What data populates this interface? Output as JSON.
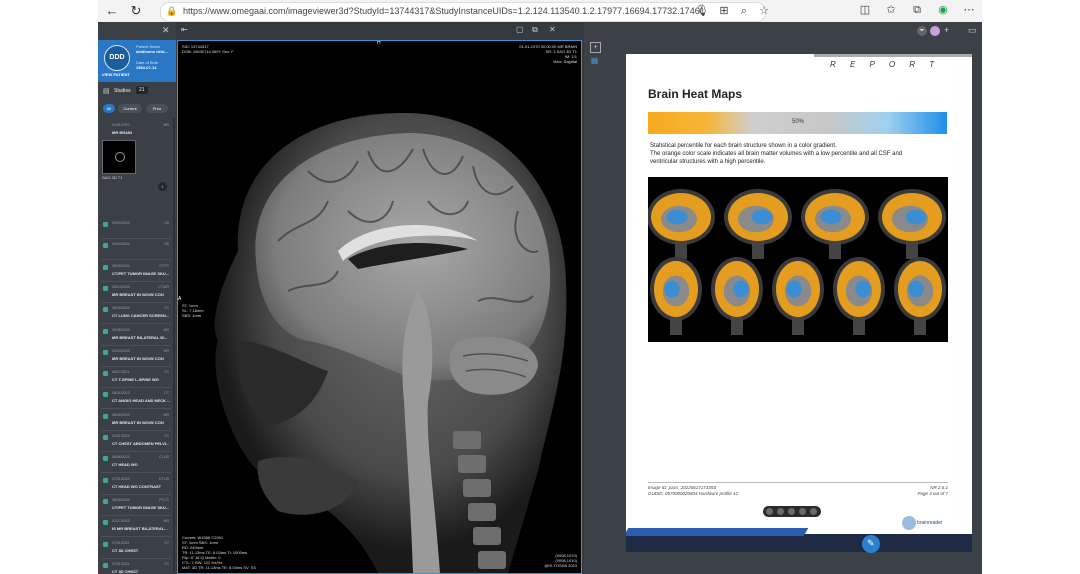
{
  "browser": {
    "url": "https://www.omegaai.com/imageviewer3d?StudyId=13744317&StudyInstanceUIDs=1.2.124.113540.1.2.17977.16694.17732.17460&PatientInfo=12..."
  },
  "sidebar": {
    "patient": {
      "avatar": "DDD",
      "name_label": "Patient Name",
      "name": "deidlonnn deid...",
      "view_label": "VIEW PATIENT",
      "dob_label": "Date of Birth",
      "dob": "1964-07-14"
    },
    "studies_label": "Studies",
    "studies_count": "21",
    "filters": [
      "All",
      "Current",
      "Prior"
    ],
    "current_study": {
      "date": "01/01/1970",
      "mod": "MR",
      "desc": "MR BRAIN",
      "thumb_label": "SAG 3D T1",
      "series_count": "1"
    },
    "studies": [
      {
        "date": "09/09/2024",
        "mod": "US",
        "desc": ""
      },
      {
        "date": "04/29/2024",
        "mod": "US",
        "desc": ""
      },
      {
        "date": "08/08/2024",
        "mod": "CT,PT",
        "desc": "CT/PET TUMOR IMAGE SKU..."
      },
      {
        "date": "08/14/2024",
        "mod": "CT,MR",
        "desc": "MR BREAST BI WO/W CON"
      },
      {
        "date": "06/16/2023",
        "mod": "CT",
        "desc": "CT LUNG CANCER SCREEN..."
      },
      {
        "date": "06/08/2023",
        "mod": "MR",
        "desc": "MR BREAST BILATERAL W..."
      },
      {
        "date": "03/03/2023",
        "mod": "MR",
        "desc": "MR BREAST BI WO/W CON"
      },
      {
        "date": "08/27/2021",
        "mod": "CT",
        "desc": "CT T-SPINE L-SPINE WO"
      },
      {
        "date": "08/31/2023",
        "mod": "CT",
        "desc": "CT ANGIO HEAD AND NECK ..."
      },
      {
        "date": "08/09/2023",
        "mod": "MR",
        "desc": "MR BREAST BI WO/W CON"
      },
      {
        "date": "04/21/2023",
        "mod": "CT",
        "desc": "CT CHEST ABDOMEN PELVI..."
      },
      {
        "date": "08/06/2021",
        "mod": "CT,US",
        "desc": "CT HEAD WO"
      },
      {
        "date": "07/21/2023",
        "mod": "CT,US",
        "desc": "CT HEAD WO CONTRAST"
      },
      {
        "date": "08/08/2023",
        "mod": "PT,CT",
        "desc": "CT/PET TUMOR IMAGE SKU..."
      },
      {
        "date": "01/27/2023",
        "mod": "MR",
        "desc": "IS MR BREAST BILATERAL..."
      },
      {
        "date": "07/01/2021",
        "mod": "CT",
        "desc": "CT 3D CHEST"
      },
      {
        "date": "07/01/2021",
        "mod": "CT",
        "desc": "CT 3D CHEST"
      }
    ]
  },
  "viewer": {
    "top_left": [
      "SID: 13744317",
      "DOB: 19640714 060Y Sex: F"
    ],
    "top_right": [
      "01-01-1970 00:00:00 MR BRAIN",
      "SR: 3 SAG 3D T1",
      "IM: 1/1",
      "View: Sagittal"
    ],
    "mid_left": [
      "ST: 1mm",
      "SL: 7.18mm",
      "SBS: 1mm"
    ],
    "bottom_left": [
      "Current: W4368 C2091",
      "ST: 1mm SBS: 1mm",
      "RD: 240mm",
      "TR: 11.13ms TE: 6.03ms TI: 1000ms",
      "Flip: 8° ACQ Matrix: 0",
      "CTL: 1 BW: 122 Hz/Hz",
      "MAT: 3D TR: 11.13ms TE: 6.03ms SV: SS"
    ],
    "bottom_right": [
      "(0008,1070)",
      "(0008,1010)",
      "@IS-TOSHA 2023"
    ],
    "marker_top": "H",
    "marker_left": "A"
  },
  "report": {
    "header_word": "R E P O R T",
    "title": "Brain Heat Maps",
    "gradient_label": "50%",
    "description": [
      "Statistical percentile for each brain structure shown in a color gradient.",
      "The orange color scale indicates all brain matter volumes with a low percentile and all CSF and",
      "ventricular structures with a high percentile."
    ],
    "footer_left": [
      "Image ID: pacs_2022061717335S",
      "GUDID: 0570000020604 Hardware profile 1C"
    ],
    "footer_right": [
      "NR 2.6.1",
      "Page 4 out of 7"
    ],
    "logo_text": "brainreader",
    "colors": {
      "orange": "#f7a91c",
      "mid": "#bfbfbf",
      "blue": "#1f8fe8"
    }
  }
}
